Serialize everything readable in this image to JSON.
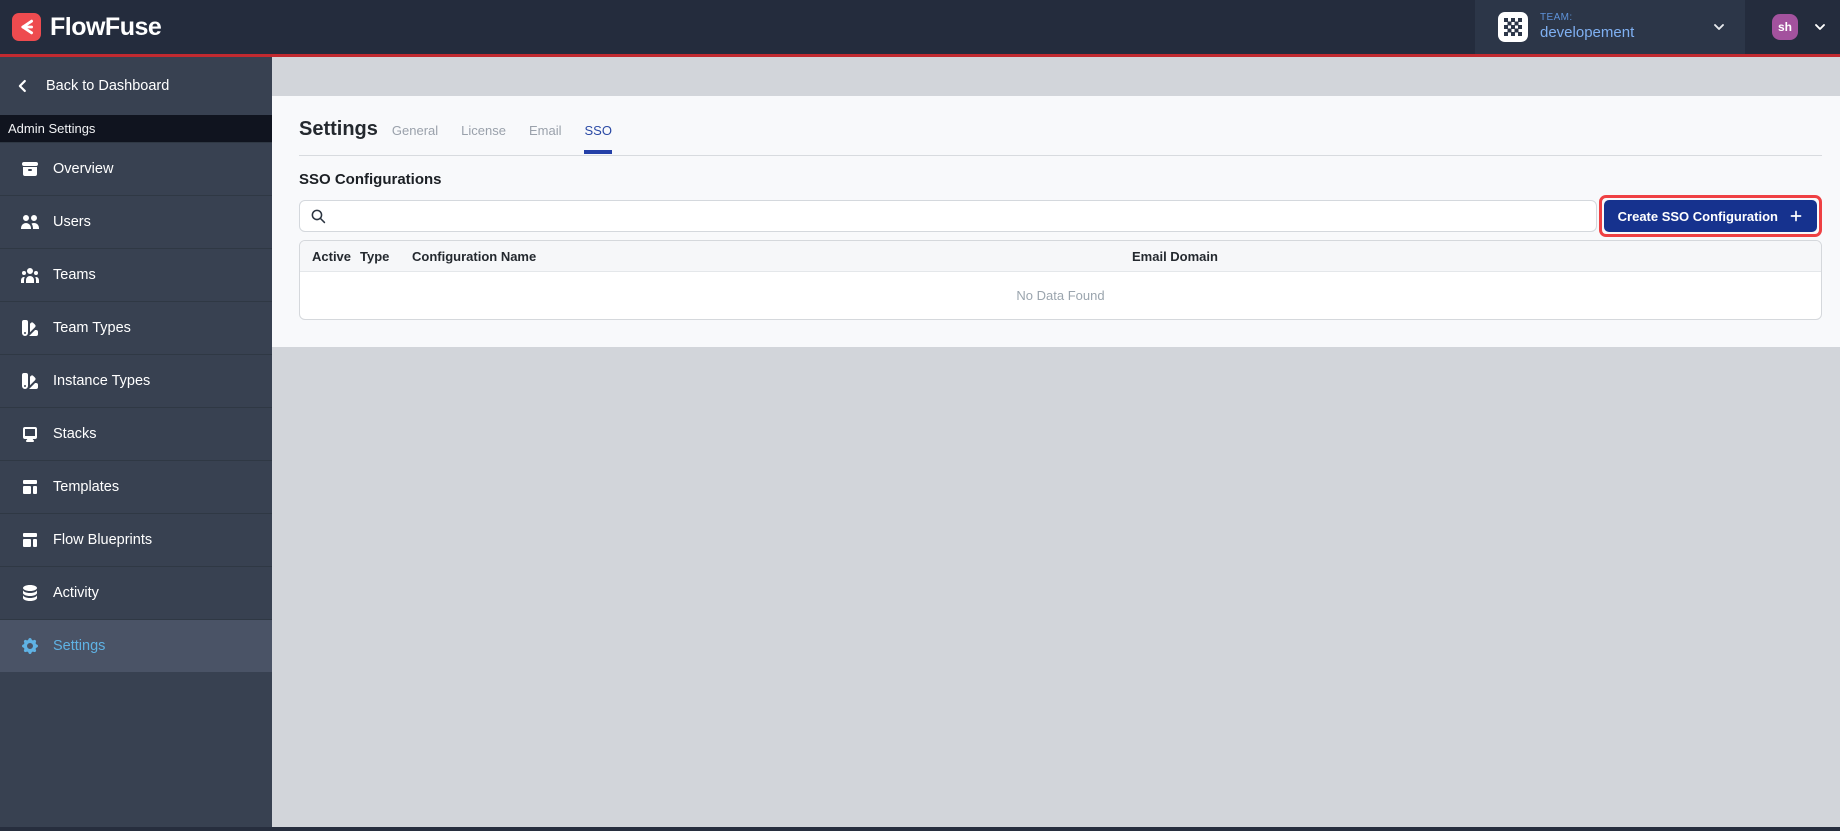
{
  "app": {
    "brand": "FlowFuse"
  },
  "header": {
    "team_label": "TEAM:",
    "team_name": "developement",
    "user_initials": "sh"
  },
  "sidebar": {
    "back_label": "Back to Dashboard",
    "section_label": "Admin Settings",
    "items": [
      {
        "label": "Overview",
        "icon": "archive-icon",
        "active": false
      },
      {
        "label": "Users",
        "icon": "users-icon",
        "active": false
      },
      {
        "label": "Teams",
        "icon": "user-group-icon",
        "active": false
      },
      {
        "label": "Team Types",
        "icon": "color-swatch-icon",
        "active": false
      },
      {
        "label": "Instance Types",
        "icon": "color-swatch-icon",
        "active": false
      },
      {
        "label": "Stacks",
        "icon": "desktop-computer-icon",
        "active": false
      },
      {
        "label": "Templates",
        "icon": "template-icon",
        "active": false
      },
      {
        "label": "Flow Blueprints",
        "icon": "template-icon",
        "active": false
      },
      {
        "label": "Activity",
        "icon": "database-icon",
        "active": false
      },
      {
        "label": "Settings",
        "icon": "cog-icon",
        "active": true
      }
    ]
  },
  "main": {
    "title": "Settings",
    "tabs": [
      {
        "label": "General",
        "active": false
      },
      {
        "label": "License",
        "active": false
      },
      {
        "label": "Email",
        "active": false
      },
      {
        "label": "SSO",
        "active": true
      }
    ],
    "section_title": "SSO Configurations",
    "search": {
      "placeholder": "",
      "value": ""
    },
    "create_button_label": "Create SSO Configuration",
    "table": {
      "columns": [
        "Active",
        "Type",
        "Configuration Name",
        "Email Domain"
      ],
      "empty_message": "No Data Found"
    }
  },
  "colors": {
    "brand_red": "#ee4b4f",
    "header_red_line": "#c22a30",
    "header_bg": "#242c3d",
    "sidebar_bg": "#384151",
    "primary_button_blue": "#16328e",
    "active_tab_blue": "#2b4aa5",
    "sidebar_active_blue": "#5fb2e4",
    "team_text_blue": "#7fb0f2",
    "avatar_purple": "#a3529e",
    "annotation_red": "#ef4043"
  }
}
